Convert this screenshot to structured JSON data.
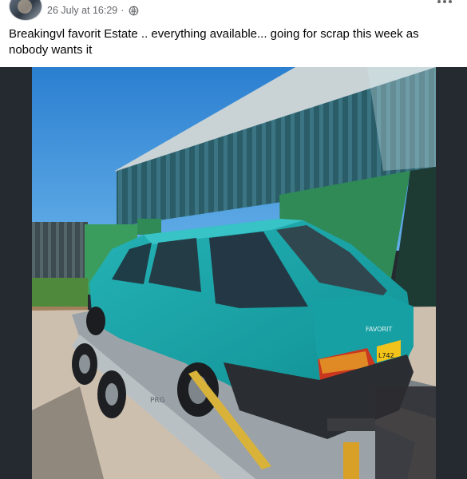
{
  "post": {
    "timestamp": "26 July at 16:29",
    "separator": "·",
    "audience_icon": "globe-icon",
    "more_icon": "more-options-icon",
    "text": "Breakingvl favorit Estate ..  everything available...  going for scrap this week as nobody wants  it"
  },
  "photo": {
    "description_icon": "photo",
    "rear_badge": "FAVORIT",
    "plate_text": "L742",
    "trailer_text": "PRG"
  },
  "colors": {
    "text": "#050505",
    "meta": "#65676b",
    "media_bg": "#252a31",
    "car": "#1aa5a8",
    "shed": "#2d5f6b",
    "door": "#2f8a55",
    "sky": "#2f86d6"
  }
}
